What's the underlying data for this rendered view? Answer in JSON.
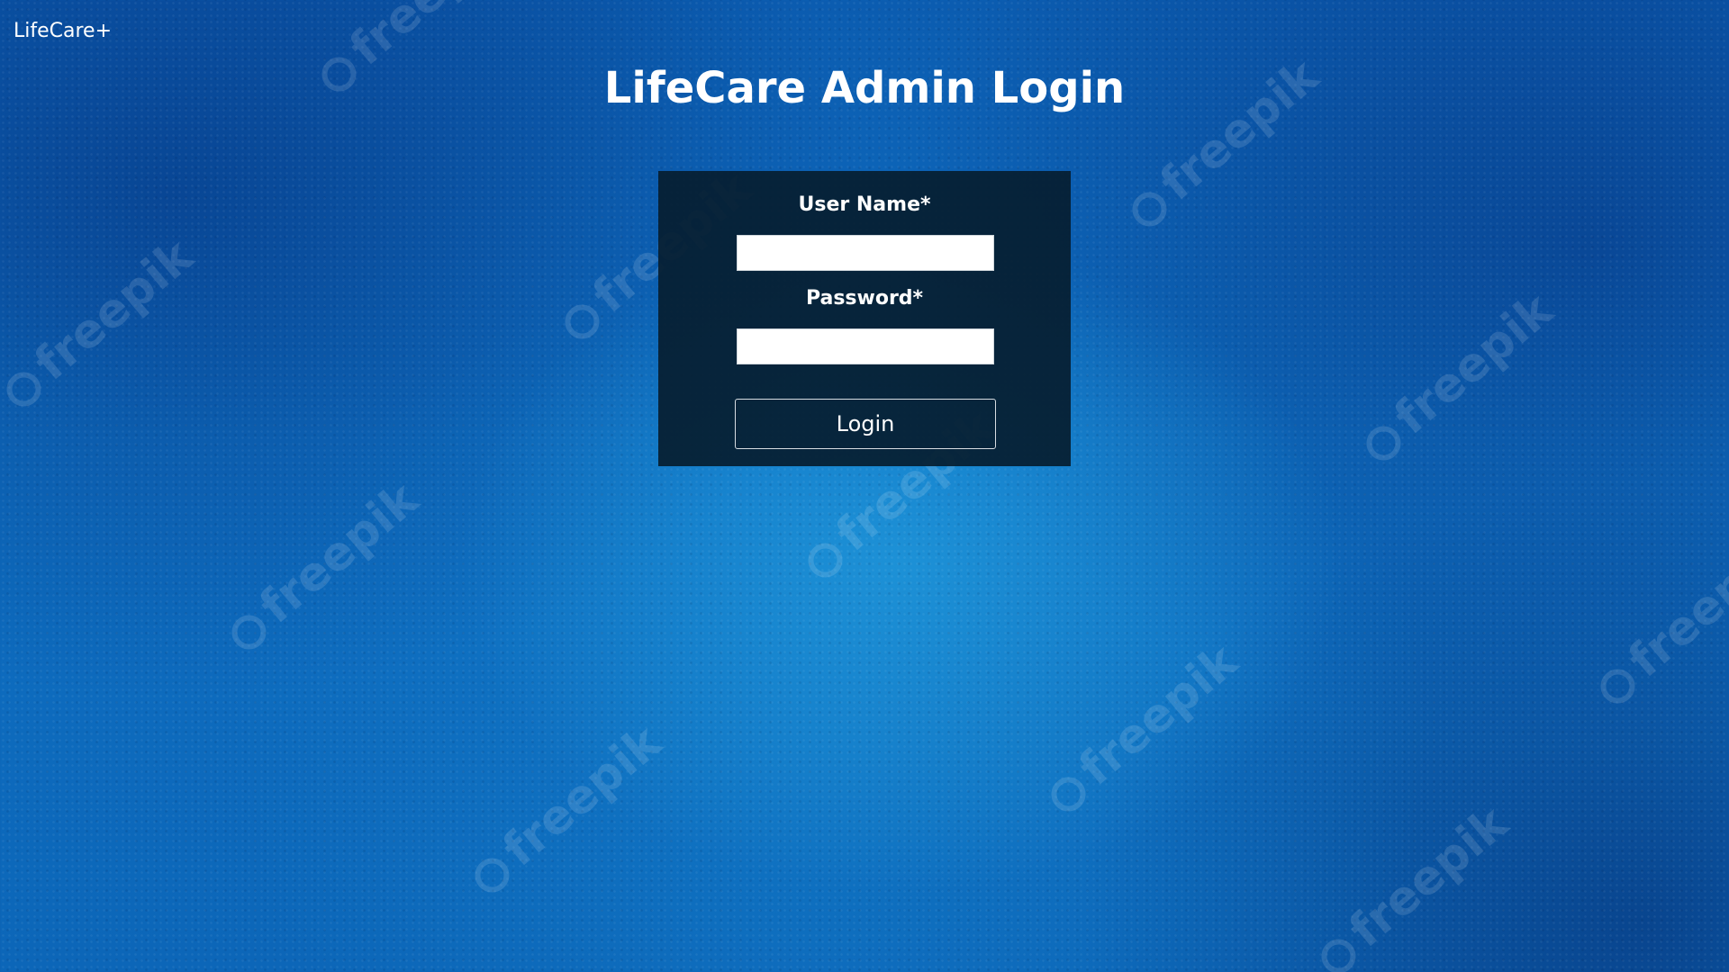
{
  "brand": {
    "name": "LifeCare+"
  },
  "page": {
    "title": "LifeCare Admin Login"
  },
  "login_form": {
    "username_label": "User Name*",
    "username_value": "",
    "password_label": "Password*",
    "password_value": "",
    "submit_label": "Login"
  },
  "background": {
    "watermark_text": "freepik",
    "colors": {
      "base": "#0e6fc2",
      "panel": "#061e30",
      "text": "#ffffff"
    }
  }
}
